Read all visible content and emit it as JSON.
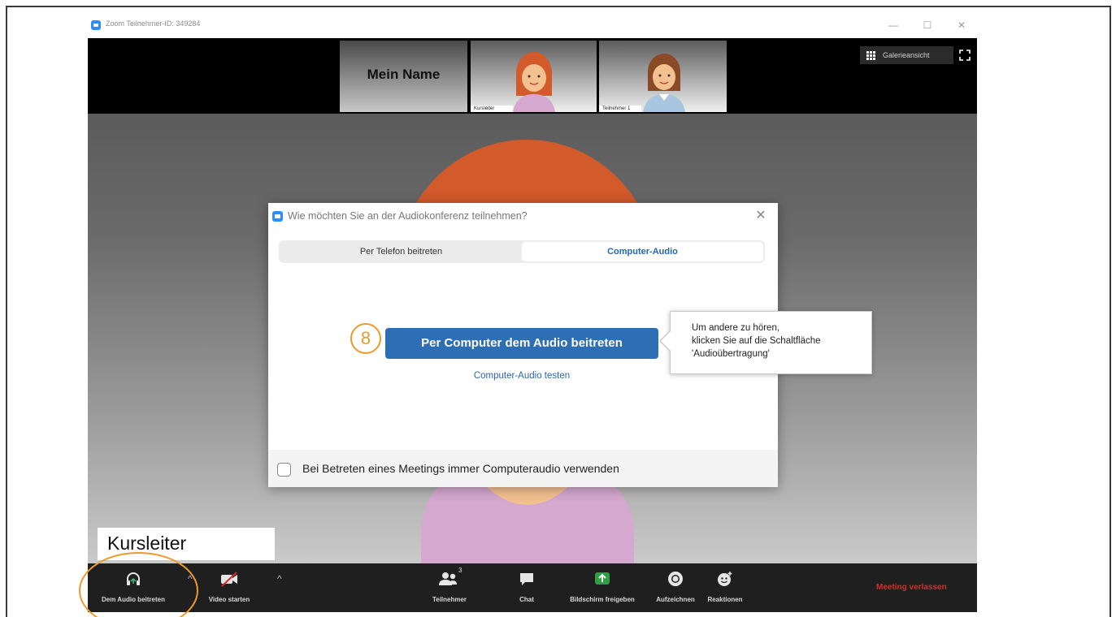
{
  "window": {
    "title": "Zoom Teilnehmer-ID: 349284",
    "minimize": "—",
    "maximize": "☐",
    "close": "✕"
  },
  "thumbnails": {
    "self_name": "Mein Name",
    "items": [
      {
        "label": "Kursleiter"
      },
      {
        "label": "Teilnehmer 1"
      }
    ]
  },
  "view": {
    "gallery_label": "Galerieansicht"
  },
  "speaker": {
    "name": "Kursleiter"
  },
  "dialog": {
    "title": "Wie möchten Sie an der Audiokonferenz teilnehmen?",
    "close": "✕",
    "tabs": [
      "Per Telefon beitreten",
      "Computer-Audio"
    ],
    "active_tab": "Computer-Audio",
    "join_button": "Per Computer dem Audio beitreten",
    "test_link": "Computer-Audio testen",
    "checkbox_label": "Bei Betreten eines Meetings immer Computeraudio verwenden",
    "checkbox_checked": false
  },
  "tooltip": {
    "lines": [
      "Um andere zu hören,",
      "klicken Sie auf die Schaltfläche",
      "'Audioübertragung'"
    ]
  },
  "step_number": "8",
  "toolbar": {
    "audio": "Dem Audio beitreten",
    "video": "Video starten",
    "participants": "Teilnehmer",
    "participants_count": "3",
    "chat": "Chat",
    "share": "Bildschirm freigeben",
    "record": "Aufzeichnen",
    "reactions": "Reaktionen",
    "leave": "Meeting verlassen"
  },
  "colors": {
    "accent_blue": "#2d6eb5",
    "zoom_blue": "#2d8cff",
    "highlight_orange": "#eb9b2c",
    "share_green": "#2ea043",
    "leave_red": "#e02828",
    "hair_orange": "#d25a2b",
    "shirt_pink": "#d4a8cf"
  }
}
